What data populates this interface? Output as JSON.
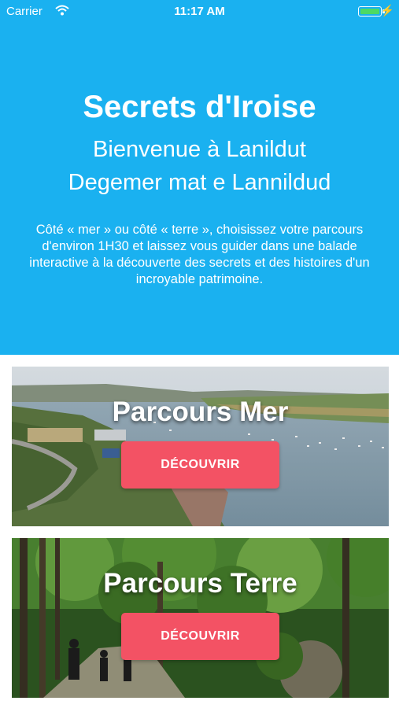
{
  "status_bar": {
    "carrier": "Carrier",
    "time": "11:17 AM",
    "wifi_icon": "wifi-icon",
    "battery_icon": "battery-icon",
    "charging_icon": "bolt-icon"
  },
  "header": {
    "title": "Secrets d'Iroise",
    "subtitle_line1": "Bienvenue à Lanildut",
    "subtitle_line2": "Degemer mat e Lannildud",
    "description": "Côté « mer » ou côté « terre », choisissez votre parcours d'environ 1H30 et laissez vous guider dans une balade interactive à la découverte des secrets et des histoires d'un incroyable patrimoine."
  },
  "cards": [
    {
      "title": "Parcours Mer",
      "button_label": "DÉCOUVRIR"
    },
    {
      "title": "Parcours Terre",
      "button_label": "DÉCOUVRIR"
    }
  ],
  "colors": {
    "header_blue": "#1ab1f0",
    "button_red": "#f35264",
    "battery_green": "#4cd964"
  }
}
